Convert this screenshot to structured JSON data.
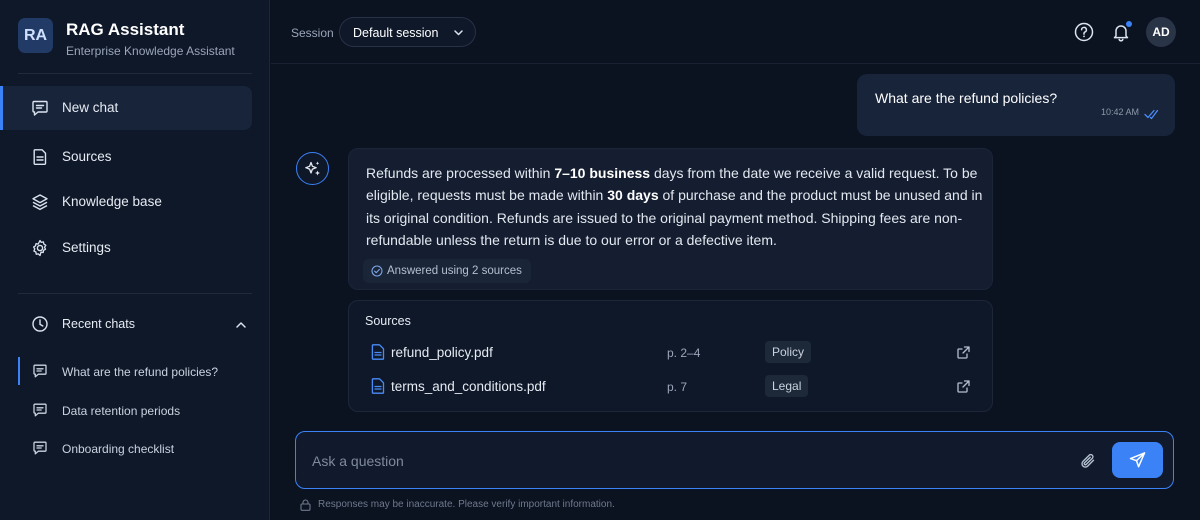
{
  "brand": {
    "initials": "RA",
    "title": "RAG Assistant",
    "subtitle": "Enterprise Knowledge Assistant"
  },
  "sidebar": {
    "nav": [
      {
        "label": "New chat",
        "icon": "chat-icon",
        "active": true
      },
      {
        "label": "Sources",
        "icon": "document-icon",
        "active": false
      },
      {
        "label": "Knowledge base",
        "icon": "layers-icon",
        "active": false
      },
      {
        "label": "Settings",
        "icon": "gear-icon",
        "active": false
      }
    ],
    "recent": {
      "label": "Recent chats",
      "expanded": true,
      "items": [
        {
          "label": "What are the refund policies?",
          "active": true
        },
        {
          "label": "Data retention periods",
          "active": false
        },
        {
          "label": "Onboarding checklist",
          "active": false
        }
      ]
    }
  },
  "header": {
    "session_label": "Session",
    "session_value": "Default session",
    "avatar_initials": "AD",
    "has_notification": true
  },
  "conversation": {
    "user_message": {
      "text": "What are the refund policies?",
      "time": "10:42 AM"
    },
    "assistant_message": {
      "parts": [
        "Refunds are processed within ",
        "7–10 business",
        " days from the date we receive a valid request. To be eligible, requests must be made within ",
        "30 days",
        " of purchase and the product must be unused and in its original condition. Refunds are issued to the original payment method. Shipping fees are non-refundable unless the return is due to our error or a defective item."
      ],
      "sources_badge": "Answered using 2 sources"
    },
    "sources": {
      "title": "Sources",
      "items": [
        {
          "file": "refund_policy.pdf",
          "pages": "p. 2–4",
          "tag": "Policy"
        },
        {
          "file": "terms_and_conditions.pdf",
          "pages": "p. 7",
          "tag": "Legal"
        }
      ]
    }
  },
  "composer": {
    "placeholder": "Ask a question",
    "disclaimer": "Responses may be inaccurate. Please verify important information."
  },
  "colors": {
    "accent": "#3b82f6",
    "background": "#0b1220",
    "sidebar": "#0f1829",
    "bubble": "#18243a"
  }
}
